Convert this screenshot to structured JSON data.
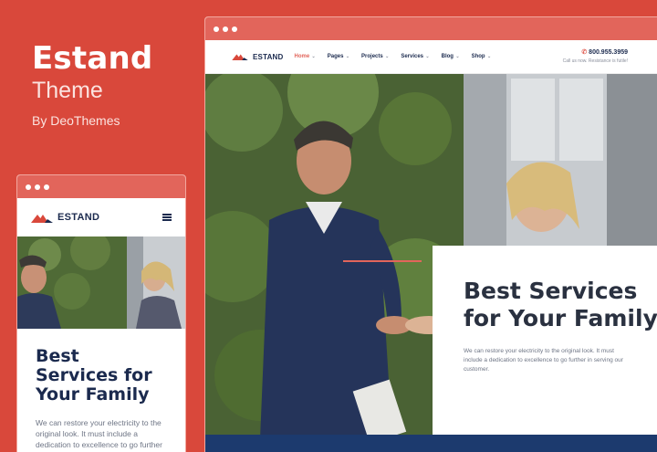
{
  "promo": {
    "title": "Estand",
    "subtitle": "Theme",
    "byline": "By DeoThemes"
  },
  "mobile": {
    "logo_text": "ESTAND",
    "heading": "Best Services for Your Family",
    "text": "We can restore your electricity to the original look. It must include a dedication to excellence to go further in serving our customer."
  },
  "desktop": {
    "logo_text": "ESTAND",
    "menu": [
      {
        "label": "Home"
      },
      {
        "label": "Pages"
      },
      {
        "label": "Projects"
      },
      {
        "label": "Services"
      },
      {
        "label": "Blog"
      },
      {
        "label": "Shop"
      }
    ],
    "phone": "800.955.3959",
    "call_text": "Call us now. Resistance is futile!",
    "hero_heading": "Best Services for Your Family",
    "hero_text": "We can restore your electricity to the original look. It must include a dedication to excellence to go further in serving our customer."
  },
  "colors": {
    "brand_red": "#d9483b",
    "navy": "#1b2a4e",
    "accent": "#e2655b"
  }
}
